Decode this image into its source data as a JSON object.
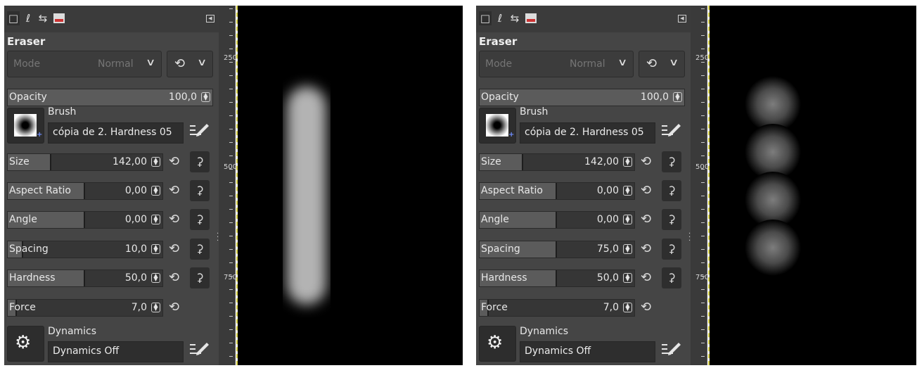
{
  "panels": [
    {
      "id": "left",
      "tool_title": "Eraser",
      "mode_label": "Mode",
      "mode_value": "Normal",
      "opacity": {
        "label": "Opacity",
        "value": "100,0"
      },
      "brush": {
        "section_label": "Brush",
        "name": "cópia de 2. Hardness 05"
      },
      "sliders": [
        {
          "label": "Size",
          "value": "142,00",
          "fill": 0.28
        },
        {
          "label": "Aspect Ratio",
          "value": "0,00",
          "fill": 0.5
        },
        {
          "label": "Angle",
          "value": "0,00",
          "fill": 0.5
        },
        {
          "label": "Spacing",
          "value": "10,0",
          "fill": 0.1
        },
        {
          "label": "Hardness",
          "value": "50,0",
          "fill": 0.5
        },
        {
          "label": "Force",
          "value": "7,0",
          "fill": 0.06
        }
      ],
      "dynamics": {
        "section_label": "Dynamics",
        "name": "Dynamics Off"
      },
      "ruler": [
        "250",
        "500",
        "750"
      ],
      "stroke": "continuous"
    },
    {
      "id": "right",
      "tool_title": "Eraser",
      "mode_label": "Mode",
      "mode_value": "Normal",
      "opacity": {
        "label": "Opacity",
        "value": "100,0"
      },
      "brush": {
        "section_label": "Brush",
        "name": "cópia de 2. Hardness 05"
      },
      "sliders": [
        {
          "label": "Size",
          "value": "142,00",
          "fill": 0.28
        },
        {
          "label": "Aspect Ratio",
          "value": "0,00",
          "fill": 0.5
        },
        {
          "label": "Angle",
          "value": "0,00",
          "fill": 0.5
        },
        {
          "label": "Spacing",
          "value": "75,0",
          "fill": 0.5
        },
        {
          "label": "Hardness",
          "value": "50,0",
          "fill": 0.5
        },
        {
          "label": "Force",
          "value": "7,0",
          "fill": 0.06
        }
      ],
      "dynamics": {
        "section_label": "Dynamics",
        "name": "Dynamics Off"
      },
      "ruler": [
        "250",
        "500",
        "750"
      ],
      "stroke": "dabs"
    }
  ],
  "icons": {
    "tab_tool_options": "tool-options-icon",
    "tab_device_status": "device-status-icon",
    "tab_undo_history": "undo-history-icon",
    "tab_images": "images-icon",
    "reset": "reset-icon",
    "chain": "chain-icon",
    "edit": "edit-icon"
  },
  "colors": {
    "panel_bg": "#454545",
    "canvas_bg": "#000000",
    "guide": "#d9d44a"
  }
}
